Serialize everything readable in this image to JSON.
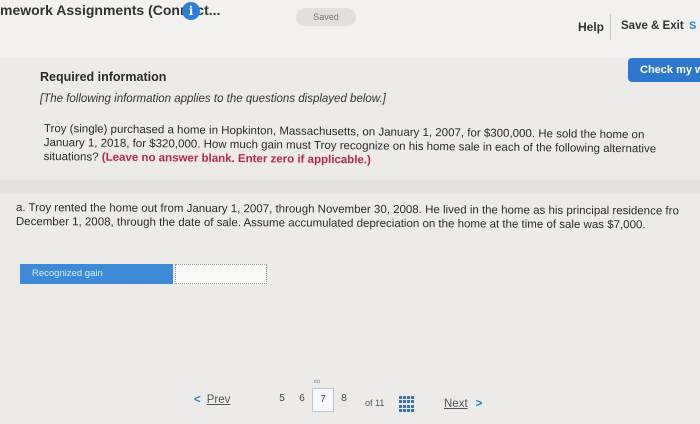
{
  "header": {
    "app_title": "mework Assignments (Connect...",
    "info_icon": "info-icon",
    "saved_label": "Saved",
    "help_label": "Help",
    "save_exit_label": "Save & Exit",
    "submit_peek": "S"
  },
  "check_button_label": "Check my w",
  "required": {
    "title": "Required information",
    "note": "[The following information applies to the questions displayed below.]",
    "body_text": "Troy (single) purchased a home in Hopkinton, Massachusetts, on January 1, 2007, for $300,000. He sold the home on January 1, 2018, for $320,000. How much gain must Troy recognize on his home sale in each of the following alternative situations?",
    "body_emphasis": "(Leave no answer blank. Enter zero if applicable.)"
  },
  "question": {
    "text": "a. Troy rented the home out from January 1, 2007, through November 30, 2008. He lived in the home as his principal residence fro December 1, 2008, through the date of sale. Assume accumulated depreciation on the home at the time of sale was $7,000."
  },
  "answer": {
    "label": "Recognized gain",
    "value": ""
  },
  "pagination": {
    "prev_label": "Prev",
    "pages": [
      "5",
      "6",
      "7",
      "8"
    ],
    "current": "7",
    "of_label": "of 11",
    "next_label": "Next"
  },
  "colors": {
    "accent_blue": "#2d78cc",
    "emphasis_red": "#b52a4a"
  }
}
